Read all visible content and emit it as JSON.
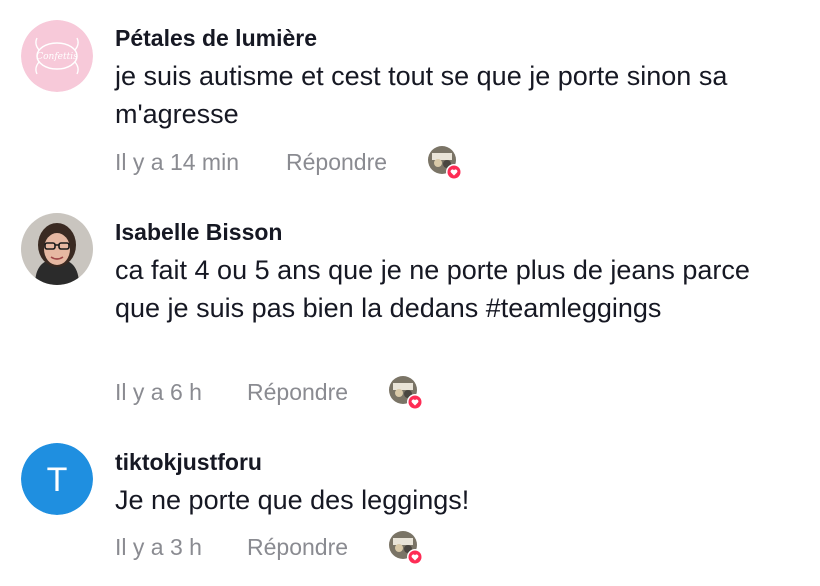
{
  "comments": [
    {
      "username": "Pétales de lumière",
      "avatar_text": "Confettis",
      "text": "je suis autisme et cest tout se que je porte sinon sa m'agresse",
      "time": "Il y a 14 min",
      "reply_label": "Répondre"
    },
    {
      "username": "Isabelle Bisson",
      "text": "ca fait 4 ou 5 ans que je ne porte plus de jeans parce que je suis pas bien la dedans #teamleggings",
      "time": "Il y a 6 h",
      "reply_label": "Répondre"
    },
    {
      "username": "tiktokjustforu",
      "avatar_initial": "T",
      "text": "Je ne porte que des leggings!",
      "time": "Il y a 3 h",
      "reply_label": "Répondre"
    }
  ],
  "colors": {
    "heart_badge": "#fe2c55",
    "meta_text": "#8a8b91",
    "initial_avatar_bg": "#1f8fe0",
    "pink_avatar_bg": "#f7c9d9"
  }
}
